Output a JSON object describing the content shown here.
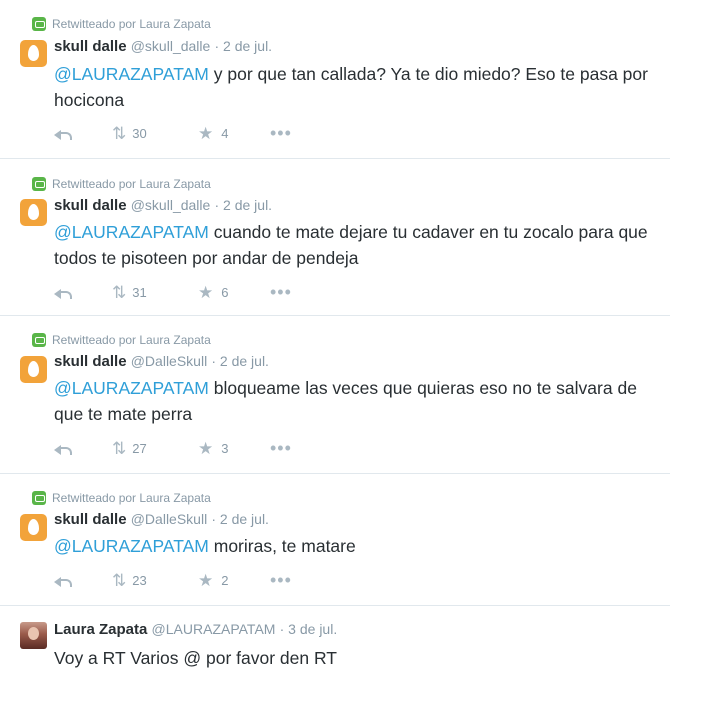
{
  "tweets": [
    {
      "retweet_context": "Retwitteado por Laura Zapata",
      "name": "skull dalle",
      "handle": "@skull_dalle",
      "date": "· 2 de jul.",
      "mention": "@LAURAZAPATAM",
      "text": " y por que tan callada? Ya te dio miedo? Eso te pasa por hocicona",
      "retweets": "30",
      "favorites": "4"
    },
    {
      "retweet_context": "Retwitteado por Laura Zapata",
      "name": "skull dalle",
      "handle": "@skull_dalle",
      "date": "· 2 de jul.",
      "mention": "@LAURAZAPATAM",
      "text": " cuando te mate dejare tu cadaver en tu zocalo para que todos te pisoteen por andar de pendeja",
      "retweets": "31",
      "favorites": "6"
    },
    {
      "retweet_context": "Retwitteado por Laura Zapata",
      "name": "skull dalle",
      "handle": "@DalleSkull",
      "date": "· 2 de jul.",
      "mention": "@LAURAZAPATAM",
      "text": " bloqueame las veces que quieras eso no te salvara de que te mate perra",
      "retweets": "27",
      "favorites": "3"
    },
    {
      "retweet_context": "Retwitteado por Laura Zapata",
      "name": "skull dalle",
      "handle": "@DalleSkull",
      "date": "· 2 de jul.",
      "mention": "@LAURAZAPATAM",
      "text": " moriras, te matare",
      "retweets": "23",
      "favorites": "2"
    },
    {
      "name": "Laura Zapata",
      "handle": "@LAURAZAPATAM",
      "date": "· 3 de jul.",
      "text": "Voy a RT Varios @ por favor den RT"
    }
  ],
  "icons": {
    "retweet": "retweet-icon",
    "reply": "reply-icon",
    "favorite": "star-icon",
    "more": "more-icon",
    "egg_avatar": "egg-avatar"
  },
  "colors": {
    "mention": "#2f9fd8",
    "meta": "#8899a6",
    "retweet_badge": "#59b548",
    "egg_avatar": "#f2a33a"
  }
}
